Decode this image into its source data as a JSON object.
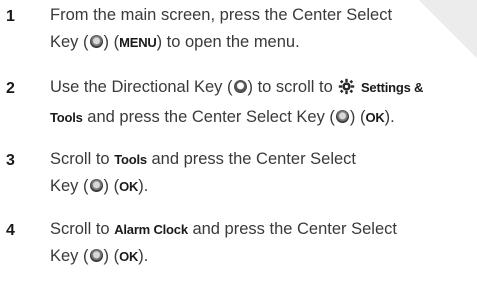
{
  "steps": [
    {
      "number": "1",
      "line1": "From the main screen, press the Center Select",
      "line2_prefix": "Key (",
      "line2_mid": ") (",
      "softkey": "MENU",
      "line2_suffix": ") to open the menu."
    },
    {
      "number": "2",
      "line1_prefix": "Use the Directional Key (",
      "line1_mid": ") to scroll to ",
      "menu_item_part1": "Settings &",
      "menu_item_part2": "Tools",
      "line2_mid": " and press the Center Select Key (",
      "line2_mid2": ") (",
      "softkey": "OK",
      "line2_suffix": ")."
    },
    {
      "number": "3",
      "line1_prefix": "Scroll to ",
      "menu_item": "Tools",
      "line1_suffix": " and press the Center Select",
      "line2_prefix": "Key (",
      "line2_mid": ") (",
      "softkey": "OK",
      "line2_suffix": ")."
    },
    {
      "number": "4",
      "line1_prefix": "Scroll to ",
      "menu_item": "Alarm Clock",
      "line1_suffix": " and press the Center Select",
      "line2_prefix": "Key (",
      "line2_mid": ") (",
      "softkey": "OK",
      "line2_suffix": ")."
    }
  ],
  "icons": {
    "center_key": "center-select-key-icon",
    "directional_key": "directional-key-icon",
    "settings": "settings-gear-icon"
  },
  "colors": {
    "text": "#3a3a3a",
    "keyword": "#1a1a1a",
    "corner": "#ececec"
  }
}
